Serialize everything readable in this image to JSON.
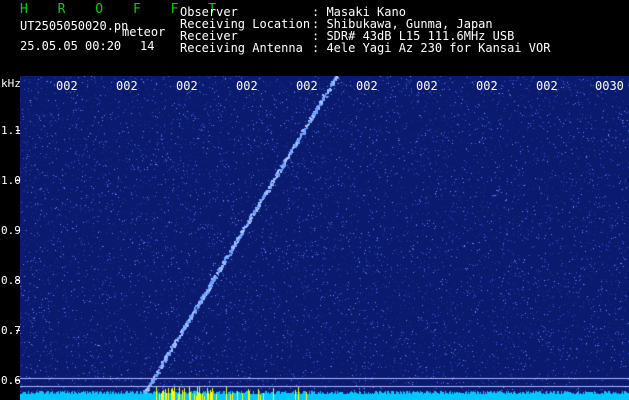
{
  "header": {
    "title": "H R O F F T",
    "file_name": "UT2505050020.pn",
    "file_suffix": "meteor",
    "datetime": "25.05.05 00:20",
    "index": "14",
    "fields": [
      {
        "label": "Observer",
        "value": ": Masaki Kano"
      },
      {
        "label": "Receiving Location",
        "value": ": Shibukawa, Gunma, Japan"
      },
      {
        "label": "Receiver",
        "value": ": SDR# 43dB L15 111.6MHz USB"
      },
      {
        "label": "Receiving Antenna",
        "value": ": 4ele Yagi Az 230 for Kansai VOR"
      }
    ]
  },
  "spectrogram": {
    "unit_label": "kHz",
    "y_ticks": [
      "1.1",
      "1.0",
      "0.9",
      "0.8",
      "0.7",
      "0.6"
    ],
    "y_range": [
      0.58,
      1.17
    ],
    "time_labels": [
      "002",
      "002",
      "002",
      "002",
      "002",
      "002",
      "002",
      "002",
      "002",
      "0030"
    ],
    "colors": {
      "background": "#0a1a6e",
      "noise": "#3c5ae6",
      "trace": "#6ea0ff",
      "baseline": "#00c8ff",
      "marker": "#ffff00",
      "guide_line": "#b4b4ff"
    },
    "trace_start": {
      "time_fraction": 0.2,
      "freq_khz": 0.585
    },
    "trace_end": {
      "time_fraction": 0.52,
      "freq_khz": 1.17
    },
    "guide_lines_khz": [
      0.62,
      0.605,
      0.59
    ]
  }
}
